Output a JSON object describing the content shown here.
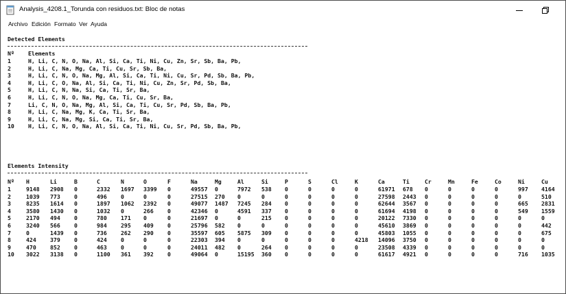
{
  "window": {
    "title": "Analysis_4208.1_Torunda con residuos.txt: Bloc de notas"
  },
  "menu": [
    "Archivo",
    "Edición",
    "Formato",
    "Ver",
    "Ayuda"
  ],
  "detected": {
    "title": "Detected Elements",
    "header_no": "Nº",
    "header_elements": "Elements",
    "rows": [
      {
        "no": "1",
        "elements": "H, Li, C, N, O, Na, Al, Si, Ca, Ti, Ni, Cu, Zn, Sr, Sb, Ba, Pb,"
      },
      {
        "no": "2",
        "elements": "H, Li, C, Na, Mg, Ca, Ti, Cu, Sr, Sb, Ba,"
      },
      {
        "no": "3",
        "elements": "H, Li, C, N, O, Na, Mg, Al, Si, Ca, Ti, Ni, Cu, Sr, Pd, Sb, Ba, Pb,"
      },
      {
        "no": "4",
        "elements": "H, Li, C, O, Na, Al, Si, Ca, Ti, Ni, Cu, Zn, Sr, Pd, Sb, Ba,"
      },
      {
        "no": "5",
        "elements": "H, Li, C, N, Na, Si, Ca, Ti, Sr, Ba,"
      },
      {
        "no": "6",
        "elements": "H, Li, C, N, O, Na, Mg, Ca, Ti, Cu, Sr, Ba,"
      },
      {
        "no": "7",
        "elements": "Li, C, N, O, Na, Mg, Al, Si, Ca, Ti, Cu, Sr, Pd, Sb, Ba, Pb,"
      },
      {
        "no": "8",
        "elements": "H, Li, C, Na, Mg, K, Ca, Ti, Sr, Ba,"
      },
      {
        "no": "9",
        "elements": "H, Li, C, Na, Mg, Si, Ca, Ti, Sr, Ba,"
      },
      {
        "no": "10",
        "elements": "H, Li, C, N, O, Na, Al, Si, Ca, Ti, Ni, Cu, Sr, Pd, Sb, Ba, Pb,"
      }
    ]
  },
  "intensity": {
    "title": "Elements Intensity",
    "columns": [
      "Nº",
      "H",
      "Li",
      "B",
      "C",
      "N",
      "O",
      "F",
      "Na",
      "Mg",
      "Al",
      "Si",
      "P",
      "S",
      "Cl",
      "K",
      "Ca",
      "Ti",
      "Cr",
      "Mn",
      "Fe",
      "Co",
      "Ni",
      "Cu"
    ],
    "rows": [
      [
        "1",
        "9148",
        "2908",
        "0",
        "2332",
        "1697",
        "3399",
        "0",
        "49557",
        "0",
        "7972",
        "538",
        "0",
        "0",
        "0",
        "0",
        "61971",
        "678",
        "0",
        "0",
        "0",
        "0",
        "997",
        "4164"
      ],
      [
        "2",
        "1039",
        "773",
        "0",
        "496",
        "0",
        "0",
        "0",
        "27515",
        "270",
        "0",
        "0",
        "0",
        "0",
        "0",
        "0",
        "27598",
        "2443",
        "0",
        "0",
        "0",
        "0",
        "0",
        "510"
      ],
      [
        "3",
        "8235",
        "1614",
        "0",
        "1897",
        "1062",
        "2392",
        "0",
        "49077",
        "1487",
        "7245",
        "284",
        "0",
        "0",
        "0",
        "0",
        "62644",
        "3567",
        "0",
        "0",
        "0",
        "0",
        "665",
        "2831"
      ],
      [
        "4",
        "3580",
        "1430",
        "0",
        "1032",
        "0",
        "266",
        "0",
        "42346",
        "0",
        "4591",
        "337",
        "0",
        "0",
        "0",
        "0",
        "61694",
        "4198",
        "0",
        "0",
        "0",
        "0",
        "549",
        "1559"
      ],
      [
        "5",
        "2170",
        "494",
        "0",
        "780",
        "171",
        "0",
        "0",
        "21697",
        "0",
        "0",
        "215",
        "0",
        "0",
        "0",
        "0",
        "20122",
        "7330",
        "0",
        "0",
        "0",
        "0",
        "0",
        "0"
      ],
      [
        "6",
        "3240",
        "566",
        "0",
        "984",
        "295",
        "409",
        "0",
        "25796",
        "582",
        "0",
        "0",
        "0",
        "0",
        "0",
        "0",
        "45610",
        "3869",
        "0",
        "0",
        "0",
        "0",
        "0",
        "442"
      ],
      [
        "7",
        "0",
        "1439",
        "0",
        "736",
        "262",
        "290",
        "0",
        "35597",
        "605",
        "5875",
        "309",
        "0",
        "0",
        "0",
        "0",
        "45803",
        "1055",
        "0",
        "0",
        "0",
        "0",
        "0",
        "675"
      ],
      [
        "8",
        "424",
        "379",
        "0",
        "424",
        "0",
        "0",
        "0",
        "22303",
        "394",
        "0",
        "0",
        "0",
        "0",
        "0",
        "4218",
        "14096",
        "3750",
        "0",
        "0",
        "0",
        "0",
        "0",
        "0"
      ],
      [
        "9",
        "470",
        "852",
        "0",
        "463",
        "0",
        "0",
        "0",
        "24011",
        "482",
        "0",
        "264",
        "0",
        "0",
        "0",
        "0",
        "23508",
        "4339",
        "0",
        "0",
        "0",
        "0",
        "0",
        "0"
      ],
      [
        "10",
        "3022",
        "3138",
        "0",
        "1100",
        "361",
        "392",
        "0",
        "49064",
        "0",
        "15195",
        "360",
        "0",
        "0",
        "0",
        "0",
        "61617",
        "4921",
        "0",
        "0",
        "0",
        "0",
        "716",
        "1035"
      ]
    ]
  }
}
